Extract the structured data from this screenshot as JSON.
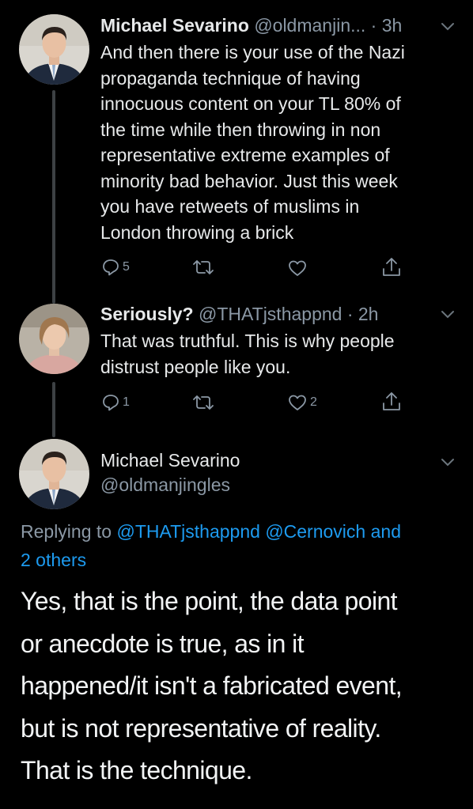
{
  "tweets": [
    {
      "display_name": "Michael Sevarino",
      "handle": "@oldmanjin...",
      "time": "· 3h",
      "text_lines": [
        "And then there is your use of the Nazi",
        "propaganda technique of having",
        "innocuous content on your TL 80% of",
        "the time while then throwing in non",
        "representative extreme examples of",
        "minority bad behavior. Just this week",
        "you have retweets of muslims in",
        "London throwing a brick"
      ],
      "reply_count": "5",
      "retweet_count": "",
      "like_count": ""
    },
    {
      "display_name": "Seriously?",
      "handle": "@THATjsthappnd",
      "time": "· 2h",
      "text_lines": [
        "That was truthful. This is why people",
        "distrust people like you."
      ],
      "reply_count": "1",
      "retweet_count": "",
      "like_count": "2"
    }
  ],
  "main_tweet": {
    "display_name": "Michael Sevarino",
    "handle": "@oldmanjingles",
    "replying_prefix": "Replying to",
    "mention_1": "@THATjsthappnd",
    "mention_2": "@Cernovich",
    "mention_and": "and",
    "mention_others": "2 others",
    "text_lines": [
      "Yes, that is the point, the data point",
      "or anecdote is true, as in it",
      "happened/it isn't a fabricated event,",
      "but is not representative of reality.",
      "That is the technique."
    ]
  },
  "icons": {
    "reply": "reply-icon",
    "retweet": "retweet-icon",
    "like": "heart-icon",
    "share": "share-icon",
    "more": "chevron-down-icon"
  },
  "colors": {
    "background": "#000000",
    "text": "#e7e9ea",
    "secondary": "#8b98a5",
    "link": "#1d9bf0",
    "thread_line": "#3d4144"
  }
}
